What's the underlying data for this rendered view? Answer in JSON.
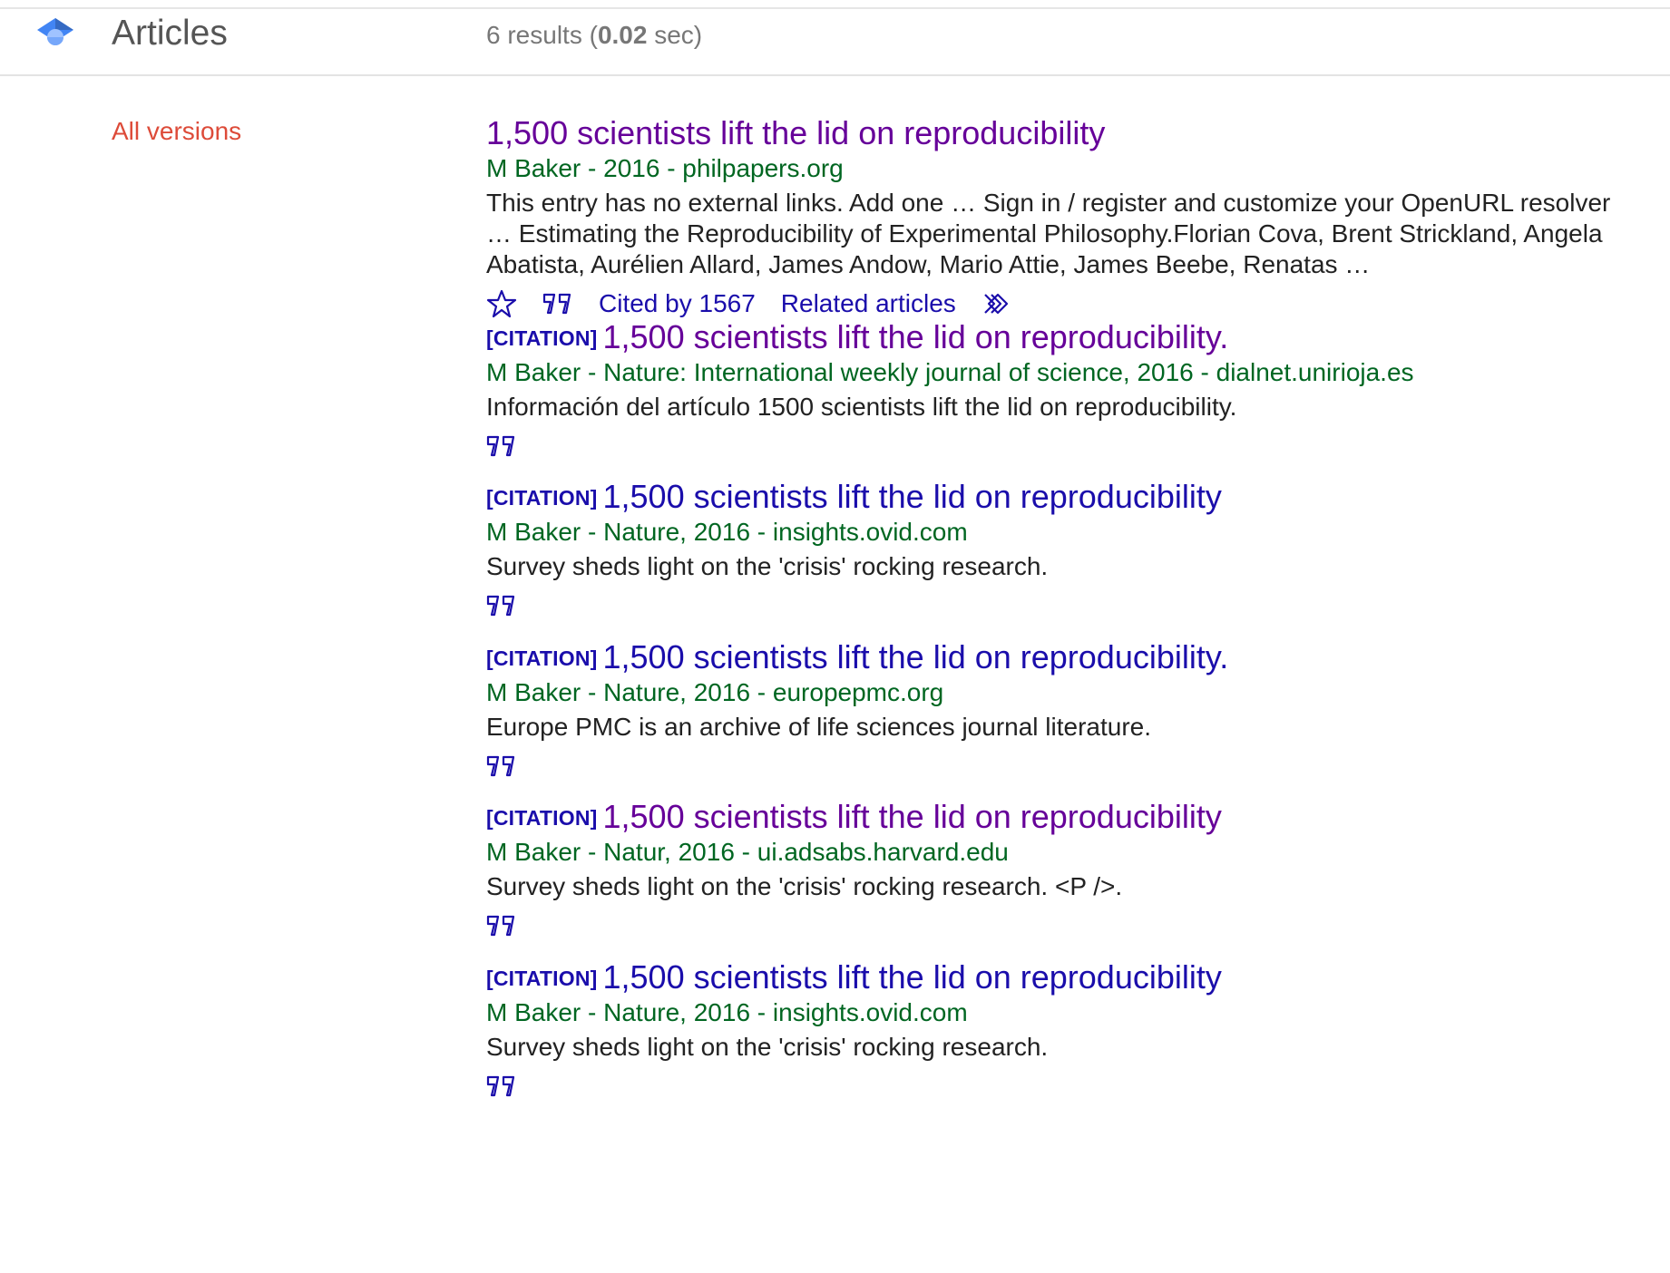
{
  "header": {
    "title": "Articles",
    "stats_prefix": "6 results (",
    "stats_time": "0.02",
    "stats_suffix": " sec)"
  },
  "sidebar": {
    "all_versions_label": "All versions"
  },
  "colors": {
    "visited_link": "#660099",
    "link": "#1a0dab",
    "byline": "#006621",
    "sidebar_link": "#dd4b39"
  },
  "results": [
    {
      "citation_tag": "",
      "title": "1,500 scientists lift the lid on reproducibility",
      "visited": true,
      "byline": "M Baker - 2016 - philpapers.org",
      "snippet": "This entry has no external links. Add one … Sign in / register and customize your OpenURL resolver … Estimating the Reproducibility of Experimental Philosophy.Florian Cova, Brent Strickland, Angela Abatista, Aurélien Allard, James Andow, Mario Attie, James Beebe, Renatas …",
      "cited_by": "Cited by 1567",
      "related": "Related articles",
      "icons": [
        "star-icon",
        "quote-icon",
        "more-icon"
      ]
    },
    {
      "citation_tag": "[CITATION]",
      "title": "1,500 scientists lift the lid on reproducibility.",
      "visited": true,
      "byline": "M Baker - Nature: International weekly journal of science, 2016 - dialnet.unirioja.es",
      "snippet": "Información del artículo 1500 scientists lift the lid on reproducibility.",
      "icons": [
        "quote-icon"
      ]
    },
    {
      "citation_tag": "[CITATION]",
      "title": "1,500 scientists lift the lid on reproducibility",
      "visited": false,
      "byline": "M Baker - Nature, 2016 - insights.ovid.com",
      "snippet": "Survey sheds light on the 'crisis' rocking research.",
      "icons": [
        "quote-icon"
      ]
    },
    {
      "citation_tag": "[CITATION]",
      "title": "1,500 scientists lift the lid on reproducibility.",
      "visited": false,
      "byline": "M Baker - Nature, 2016 - europepmc.org",
      "snippet": "Europe PMC is an archive of life sciences journal literature.",
      "icons": [
        "quote-icon"
      ]
    },
    {
      "citation_tag": "[CITATION]",
      "title": "1,500 scientists lift the lid on reproducibility",
      "visited": true,
      "byline": "M Baker - Natur, 2016 - ui.adsabs.harvard.edu",
      "snippet": "Survey sheds light on the 'crisis' rocking research. <P />.",
      "icons": [
        "quote-icon"
      ]
    },
    {
      "citation_tag": "[CITATION]",
      "title": "1,500 scientists lift the lid on reproducibility",
      "visited": false,
      "byline": "M Baker - Nature, 2016 - insights.ovid.com",
      "snippet": "Survey sheds light on the 'crisis' rocking research.",
      "icons": [
        "quote-icon"
      ]
    }
  ]
}
